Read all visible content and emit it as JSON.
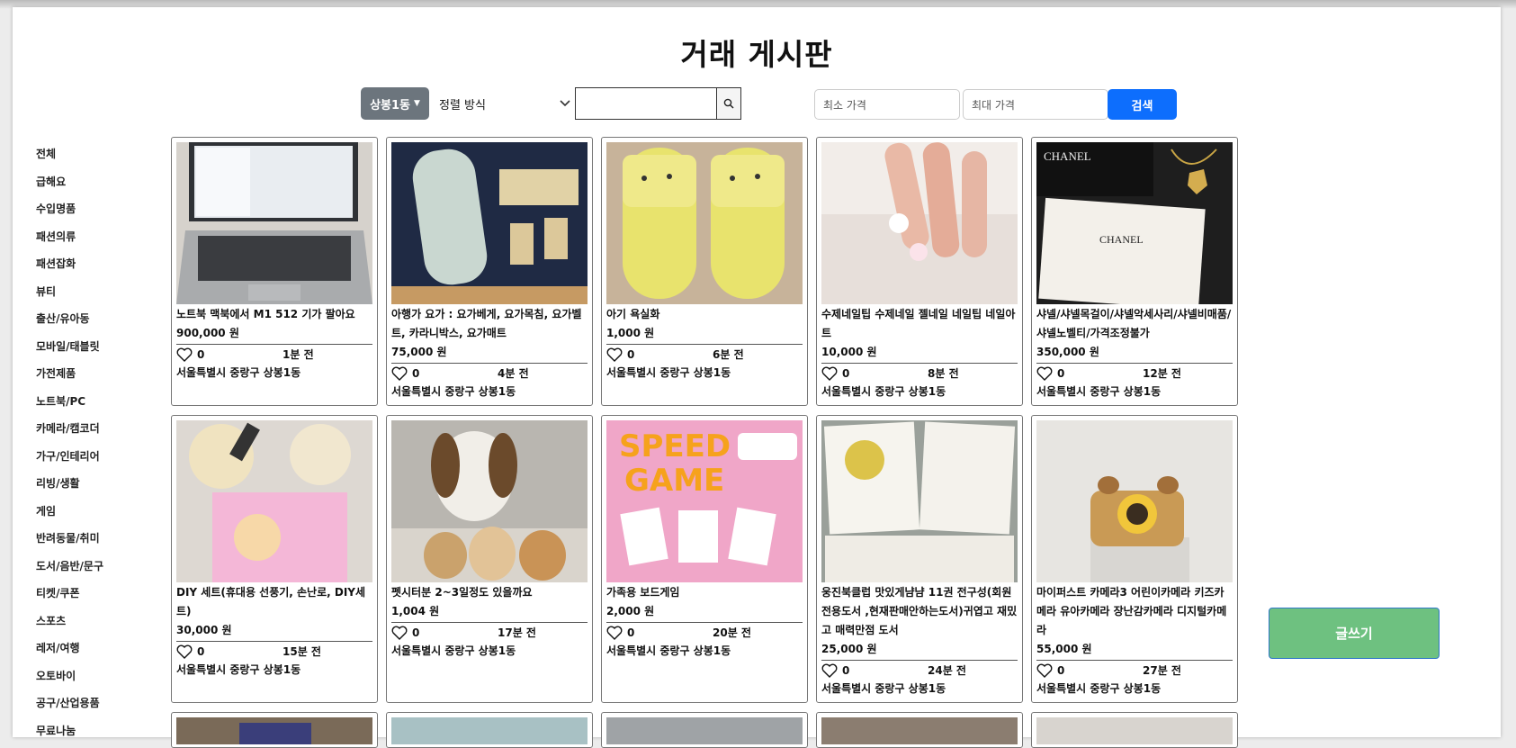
{
  "page": {
    "title": "거래 게시판"
  },
  "filters": {
    "region_label": "상봉1동",
    "sort_label": "정렬 방식",
    "search_value": "",
    "min_price_placeholder": "최소 가격",
    "max_price_placeholder": "최대 가격",
    "price_search_label": "검색"
  },
  "sidebar": {
    "categories": [
      "전체",
      "급해요",
      "수입명품",
      "패션의류",
      "패션잡화",
      "뷰티",
      "출산/유아동",
      "모바일/태블릿",
      "가전제품",
      "노트북/PC",
      "카메라/캠코더",
      "가구/인테리어",
      "리빙/생활",
      "게임",
      "반려동물/취미",
      "도서/음반/문구",
      "티켓/쿠폰",
      "스포츠",
      "레저/여행",
      "오토바이",
      "공구/산업용품",
      "무료나눔"
    ]
  },
  "products": [
    {
      "title": "노트북 맥북에서 M1 512 기가 팔아요",
      "price": "900,000 원",
      "likes": "0",
      "time": "1분 전",
      "location": "서울특별시 중랑구 상봉1동",
      "image": "laptop"
    },
    {
      "title": "아행가 요가 : 요가베게, 요가목침, 요가벨트, 카라니박스, 요가매트",
      "price": "75,000 원",
      "likes": "0",
      "time": "4분 전",
      "location": "서울특별시 중랑구 상봉1동",
      "image": "yoga-props"
    },
    {
      "title": "아기 욕실화",
      "price": "1,000 원",
      "likes": "0",
      "time": "6분 전",
      "location": "서울특별시 중랑구 상봉1동",
      "image": "slippers"
    },
    {
      "title": "수제네일팁 수제네일 젤네일 네일팁 네일아트",
      "price": "10,000 원",
      "likes": "0",
      "time": "8분 전",
      "location": "서울특별시 중랑구 상봉1동",
      "image": "nails"
    },
    {
      "title": "샤넬/샤넬목걸이/샤넬악세사리/샤넬비매품/샤넬노벨티/가격조정불가",
      "price": "350,000 원",
      "likes": "0",
      "time": "12분 전",
      "location": "서울특별시 중랑구 상봉1동",
      "image": "chanel"
    },
    {
      "title": "DIY 세트(휴대용 선풍기, 손난로, DIY세트)",
      "price": "30,000 원",
      "likes": "0",
      "time": "15분 전",
      "location": "서울특별시 중랑구 상봉1동",
      "image": "diy"
    },
    {
      "title": "펫시터분 2~3일정도 있을까요",
      "price": "1,004 원",
      "likes": "0",
      "time": "17분 전",
      "location": "서울특별시 중랑구 상봉1동",
      "image": "dog"
    },
    {
      "title": "가족용 보드게임",
      "price": "2,000 원",
      "likes": "0",
      "time": "20분 전",
      "location": "서울특별시 중랑구 상봉1동",
      "image": "boardgame"
    },
    {
      "title": "웅진북클럽 맛있게냠냠 11권 전구성(회원전용도서 ,현재판매안하는도서)귀엽고 재밌고 매력만점 도서",
      "price": "25,000 원",
      "likes": "0",
      "time": "24분 전",
      "location": "서울특별시 중랑구 상봉1동",
      "image": "book"
    },
    {
      "title": "마이퍼스트 카메라3 어린이카메라 키즈카메라 유아카메라 장난감카메라 디지털카메라",
      "price": "55,000 원",
      "likes": "0",
      "time": "27분 전",
      "location": "서울특별시 중랑구 상봉1동",
      "image": "kid-camera"
    }
  ],
  "write_button_label": "글쓰기",
  "thumb_text": {
    "chanel_1": "CHANEL",
    "chanel_2": "CHANEL",
    "game_1": "SPEED",
    "game_2": "GAME"
  }
}
